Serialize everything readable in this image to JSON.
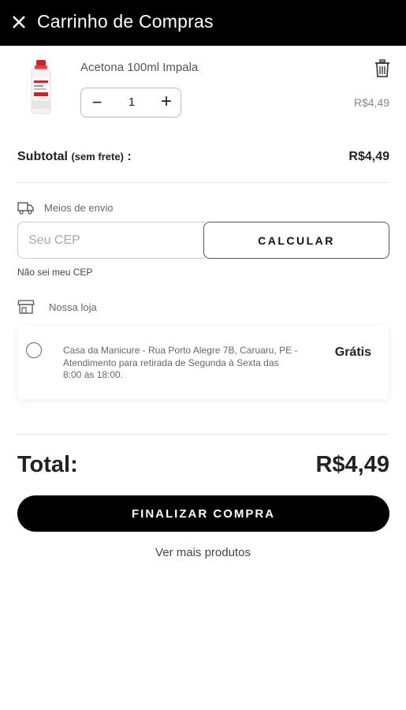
{
  "header": {
    "title": "Carrinho de Compras",
    "close_icon": "close-icon"
  },
  "cart": {
    "items": [
      {
        "name": "Acetona 100ml Impala",
        "quantity": "1",
        "price": "R$4,49",
        "image_icon": "acetone-bottle",
        "delete_icon": "trash-icon"
      }
    ]
  },
  "subtotal": {
    "label": "Subtotal",
    "label_note": "(sem frete)",
    "label_suffix": " :",
    "value": "R$4,49"
  },
  "shipping": {
    "icon": "truck-icon",
    "label": "Meios de envio",
    "cep_placeholder": "Seu CEP",
    "calculate_label": "CALCULAR",
    "unknown_cep_link": "Não sei meu CEP"
  },
  "store": {
    "icon": "store-icon",
    "label": "Nossa loja",
    "option": {
      "description": "Casa da Manicure - Rua Porto Alegre 7B, Caruaru, PE - Atendimento para retirada de Segunda à Sexta das 8:00 às 18:00.",
      "price": "Grátis"
    }
  },
  "total": {
    "label": "Total:",
    "value": "R$4,49"
  },
  "actions": {
    "checkout_label": "FINALIZAR COMPRA",
    "more_products_label": "Ver mais produtos"
  },
  "colors": {
    "header_bg": "#000000",
    "accent_red": "#d32027"
  }
}
